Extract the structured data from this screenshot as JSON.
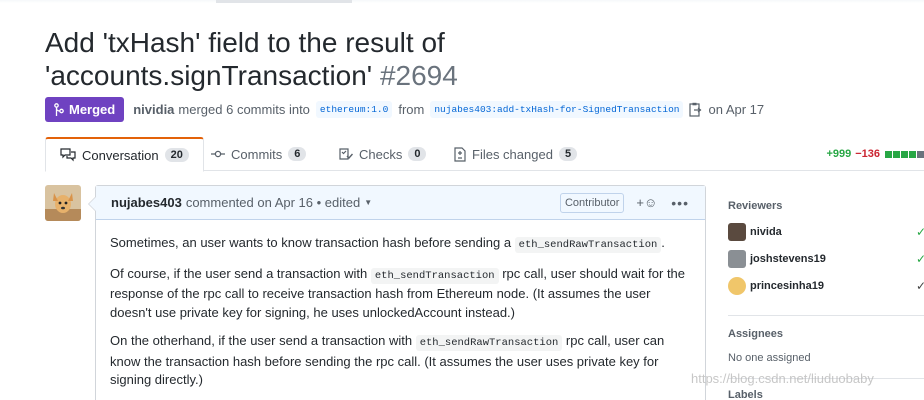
{
  "pr": {
    "title_main": "Add 'txHash' field to the result of 'accounts.signTransaction'",
    "number": "#2694",
    "state": "Merged",
    "author": "nividia",
    "merge_text": "merged 6 commits into",
    "base_branch": "ethereum:1.0",
    "from_text": "from",
    "head_branch": "nujabes403:add-txHash-for-SignedTransaction",
    "date": "on Apr 17"
  },
  "tabs": [
    {
      "label": "Conversation",
      "count": "20",
      "icon": "comment-discussion-icon"
    },
    {
      "label": "Commits",
      "count": "6",
      "icon": "git-commit-icon"
    },
    {
      "label": "Checks",
      "count": "0",
      "icon": "checklist-icon"
    },
    {
      "label": "Files changed",
      "count": "5",
      "icon": "file-diff-icon"
    }
  ],
  "diffstat": {
    "additions": "+999",
    "deletions": "−136",
    "colors": [
      "#28a745",
      "#28a745",
      "#28a745",
      "#28a745",
      "#6a737d"
    ]
  },
  "comment": {
    "author": "nujabes403",
    "meta": "commented on Apr 16 • edited",
    "badge": "Contributor",
    "paragraphs": [
      [
        "Sometimes, an user wants to know transaction hash before sending a ",
        "eth_sendRawTransaction",
        "."
      ],
      [
        "Of course, if the user send a transaction with ",
        "eth_sendTransaction",
        " rpc call, user should wait for the response of the rpc call to receive transaction hash from Ethereum node. (It assumes the user doesn't use private key for signing, he uses unlockedAccount instead.)"
      ],
      [
        "On the otherhand, if the user send a transaction with ",
        "eth_sendRawTransaction",
        " rpc call, user can know the transaction hash before sending the rpc call. (It assumes the user uses private key for signing directly.)"
      ]
    ]
  },
  "sidebar": {
    "reviewers_title": "Reviewers",
    "reviewers": [
      "nivida",
      "joshstevens19",
      "princesinha19"
    ],
    "assignees_title": "Assignees",
    "assignees_none": "No one assigned",
    "labels_title": "Labels"
  },
  "watermark": "https://blog.csdn.net/liuduobaby"
}
